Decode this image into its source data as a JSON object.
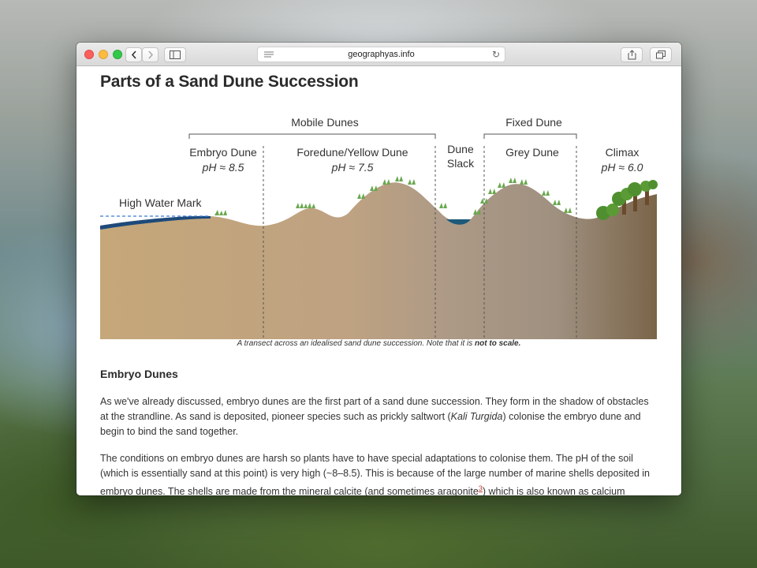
{
  "browser": {
    "url": "geographyas.info"
  },
  "page": {
    "title": "Parts of a Sand Dune Succession",
    "diagram": {
      "mobile_dunes": "Mobile Dunes",
      "fixed_dune": "Fixed Dune",
      "embryo_label": "Embryo Dune",
      "embryo_ph": "pH ≈ 8.5",
      "foredune_label": "Foredune/Yellow Dune",
      "foredune_ph": "pH ≈ 7.5",
      "slack_label_1": "Dune",
      "slack_label_2": "Slack",
      "grey_label": "Grey Dune",
      "climax_label": "Climax",
      "climax_ph": "pH ≈ 6.0",
      "high_water": "High Water Mark",
      "colors": {
        "sand_start": "#c3a579",
        "sand_mid": "#b09a86",
        "sand_end": "#7e6a4e",
        "sea": "#1d4a7a",
        "slack_water": "#1c5a7a",
        "plant": "#6aa84f",
        "tree": "#4f8f2f"
      }
    },
    "caption_prefix": "A transect across an idealised sand dune succession. Note that it is ",
    "caption_bold": "not to scale.",
    "section_heading": "Embryo Dunes",
    "para1_a": "As we've already discussed, embryo dunes are the first part of a sand dune succession. They form in the shadow of obstacles at the strandline. As sand is deposited, pioneer species such as prickly saltwort (",
    "para1_italic": "Kali Turgida",
    "para1_b": ") colonise the embryo dune and begin to bind the sand together.",
    "para2_a": "The conditions on embryo dunes are harsh so plants have to have special adaptations to colonise them. The pH of the soil (which is essentially sand at this point) is very high (~8–8.5). This is because of the large number of marine shells deposited in embryo dunes. The shells are made from the mineral calcite (and sometimes aragonite",
    "para2_cite": "3",
    "para2_b": ") which is also known as calcium"
  }
}
